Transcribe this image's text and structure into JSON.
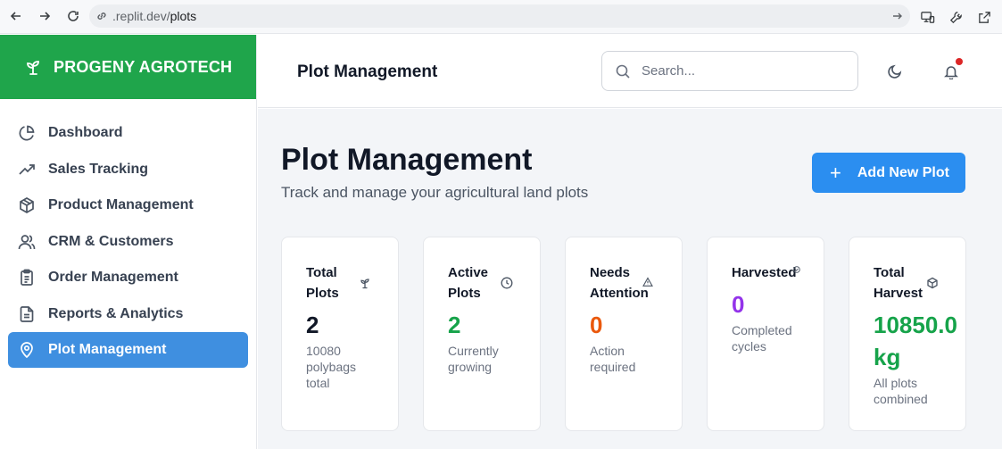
{
  "browser": {
    "url_domain": ".replit.dev/",
    "url_path": "plots"
  },
  "sidebar": {
    "brand": "PROGENY AGROTECH",
    "items": [
      {
        "label": "Dashboard",
        "icon": "pie-chart-icon"
      },
      {
        "label": "Sales Tracking",
        "icon": "trending-up-icon"
      },
      {
        "label": "Product Management",
        "icon": "box-icon"
      },
      {
        "label": "CRM & Customers",
        "icon": "users-icon"
      },
      {
        "label": "Order Management",
        "icon": "clipboard-icon"
      },
      {
        "label": "Reports & Analytics",
        "icon": "file-text-icon"
      },
      {
        "label": "Plot Management",
        "icon": "map-pin-icon",
        "active": true
      }
    ]
  },
  "header": {
    "title": "Plot Management",
    "search_placeholder": "Search..."
  },
  "main": {
    "title": "Plot Management",
    "subtitle": "Track and manage your agricultural land plots",
    "add_button": "Add New Plot",
    "cards": [
      {
        "title": "Total Plots",
        "value": "2",
        "desc": "10080 polybags total",
        "color": "#111827",
        "icon": "sprout-icon"
      },
      {
        "title": "Active Plots",
        "value": "2",
        "desc": "Currently growing",
        "color": "#16a34a",
        "icon": "clock-icon"
      },
      {
        "title": "Needs Attention",
        "value": "0",
        "desc": "Action required",
        "color": "#ea580c",
        "icon": "alert-triangle-icon"
      },
      {
        "title": "Harvested",
        "value": "0",
        "desc": "Completed cycles",
        "color": "#9333ea",
        "icon": "check-circle-icon"
      },
      {
        "title": "Total Harvest",
        "value": "10850.0 kg",
        "desc": "All plots combined",
        "color": "#16a34a",
        "icon": "package-icon"
      }
    ]
  },
  "colors": {
    "brand_green": "#1fa54b",
    "active_nav": "#3f8fe0",
    "primary_button": "#2b8ef0",
    "notification_dot": "#dc2626"
  }
}
